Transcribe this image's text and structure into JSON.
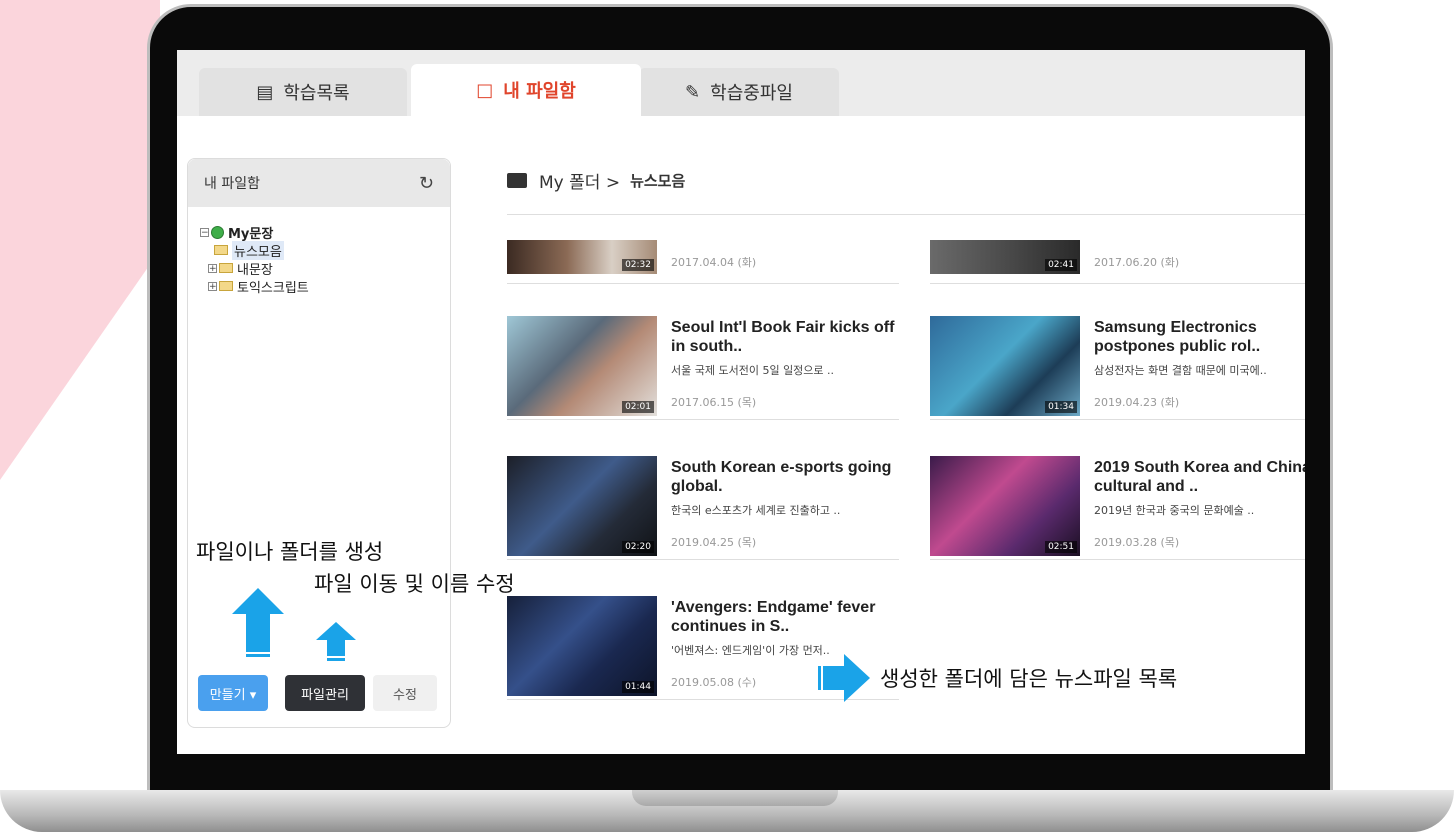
{
  "tabs": [
    {
      "label": "학습목록",
      "icon": "clipboard-icon"
    },
    {
      "label": "내 파일함",
      "icon": "folder-icon"
    },
    {
      "label": "학습중파일",
      "icon": "pencil-icon"
    }
  ],
  "sidebar": {
    "title": "내 파일함",
    "tree": [
      {
        "label": "My문장"
      },
      {
        "label": "뉴스모음"
      },
      {
        "label": "내문장"
      },
      {
        "label": "토익스크립트"
      }
    ],
    "buttons": {
      "make": "만들기 ▾",
      "file_manage": "파일관리",
      "edit": "수정"
    }
  },
  "breadcrumb": {
    "root": "My 폴더 >",
    "current": "뉴스모음"
  },
  "items": [
    {
      "title": "",
      "desc": "",
      "date": "2017.04.04 (화)",
      "duration": "02:32"
    },
    {
      "title": "",
      "desc": "",
      "date": "2017.06.20 (화)",
      "duration": "02:41"
    },
    {
      "title": "Seoul Int'l Book Fair kicks off in south..",
      "desc": "서울 국제 도서전이 5일 일정으로 ..",
      "date": "2017.06.15 (목)",
      "duration": "02:01"
    },
    {
      "title": "Samsung Electronics postpones public rol..",
      "desc": "삼성전자는 화면 결함 때문에 미국에..",
      "date": "2019.04.23 (화)",
      "duration": "01:34"
    },
    {
      "title": "South Korean e-sports going global.",
      "desc": "한국의 e스포츠가 세계로 진출하고 ..",
      "date": "2019.04.25 (목)",
      "duration": "02:20"
    },
    {
      "title": "2019 South Korea and China cultural and ..",
      "desc": "2019년 한국과 중국의 문화예술 ..",
      "date": "2019.03.28 (목)",
      "duration": "02:51"
    },
    {
      "title": "'Avengers: Endgame' fever continues in S..",
      "desc": "'어벤져스: 엔드게임'이 가장 먼저..",
      "date": "2019.05.08 (수)",
      "duration": "01:44"
    }
  ],
  "annotations": {
    "create": "파일이나 폴더를 생성",
    "move": "파일 이동 및 이름 수정",
    "list": "생성한 폴더에 담은 뉴스파일 목록"
  },
  "colors": {
    "accent_tab": "#e0452c",
    "make_button": "#4aa0ee",
    "arrow": "#1aa3e8",
    "pink": "#f7c9d2"
  }
}
